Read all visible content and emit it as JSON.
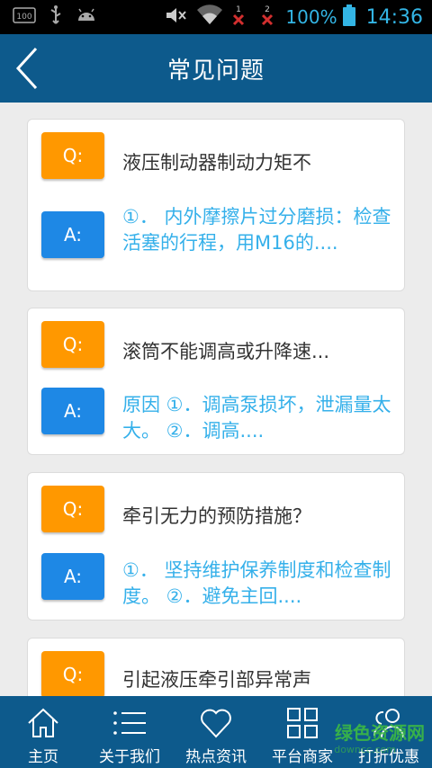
{
  "status_bar": {
    "notification_badge": "100",
    "sim1": "1",
    "sim2": "2",
    "battery_pct": "100%",
    "time": "14:36",
    "accent": "#33b5e5"
  },
  "header": {
    "title": "常见问题",
    "background": "#0d5a8c"
  },
  "faq": {
    "q_label": "Q:",
    "a_label": "A:",
    "items": [
      {
        "question": "液压制动器制动力矩不",
        "answer": "①． 内外摩擦片过分磨损：检查活塞的行程，用M16的...."
      },
      {
        "question": "滚筒不能调高或升降速...",
        "answer": "原因 ①．调高泵损坏，泄漏量太大。 ②．调高...."
      },
      {
        "question": "牵引无力的预防措施？",
        "answer": "①． 坚持维护保养制度和检查制度。 ②．避免主回...."
      },
      {
        "question": "引起液压牵引部异常声",
        "answer": ""
      }
    ]
  },
  "bottom_nav": {
    "items": [
      {
        "label": "主页",
        "icon": "home-icon"
      },
      {
        "label": "关于我们",
        "icon": "list-icon"
      },
      {
        "label": "热点资讯",
        "icon": "heart-icon"
      },
      {
        "label": "平台商家",
        "icon": "grid-icon"
      },
      {
        "label": "打折优惠",
        "icon": "users-icon"
      }
    ]
  },
  "watermark": {
    "text": "绿色资源网",
    "sub": "downcc.com"
  }
}
